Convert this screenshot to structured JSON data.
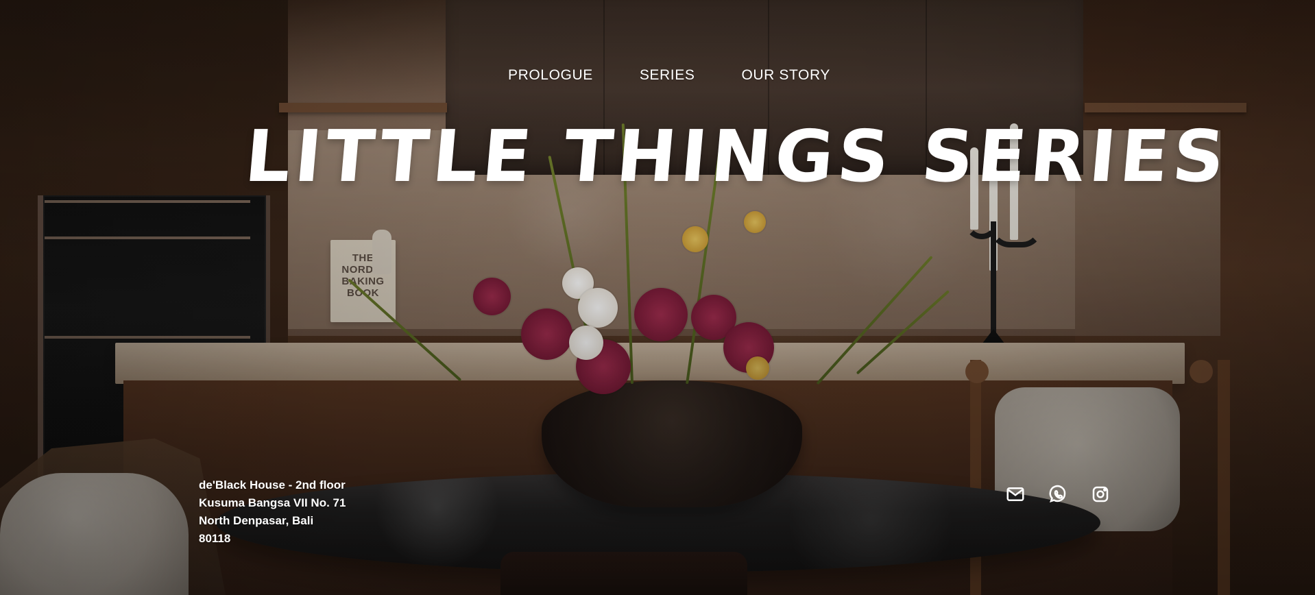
{
  "navigation": {
    "items": [
      {
        "label": "PROLOGUE"
      },
      {
        "label": "SERIES"
      },
      {
        "label": "OUR STORY"
      }
    ]
  },
  "hero": {
    "title": "LITTLE THINGS SERIES"
  },
  "book": {
    "lines": [
      "THE",
      "NORDIC",
      "BAKING",
      "BOOK"
    ]
  },
  "address": {
    "lines": [
      "de'Black House - 2nd floor",
      "Kusuma Bangsa VII No. 71",
      "North Denpasar, Bali",
      "80118"
    ]
  },
  "social": {
    "icons": [
      "mail-icon",
      "whatsapp-icon",
      "instagram-icon"
    ]
  },
  "colors": {
    "text": "#ffffff",
    "overlay": "#000000",
    "accent_wood": "#6a4328"
  }
}
